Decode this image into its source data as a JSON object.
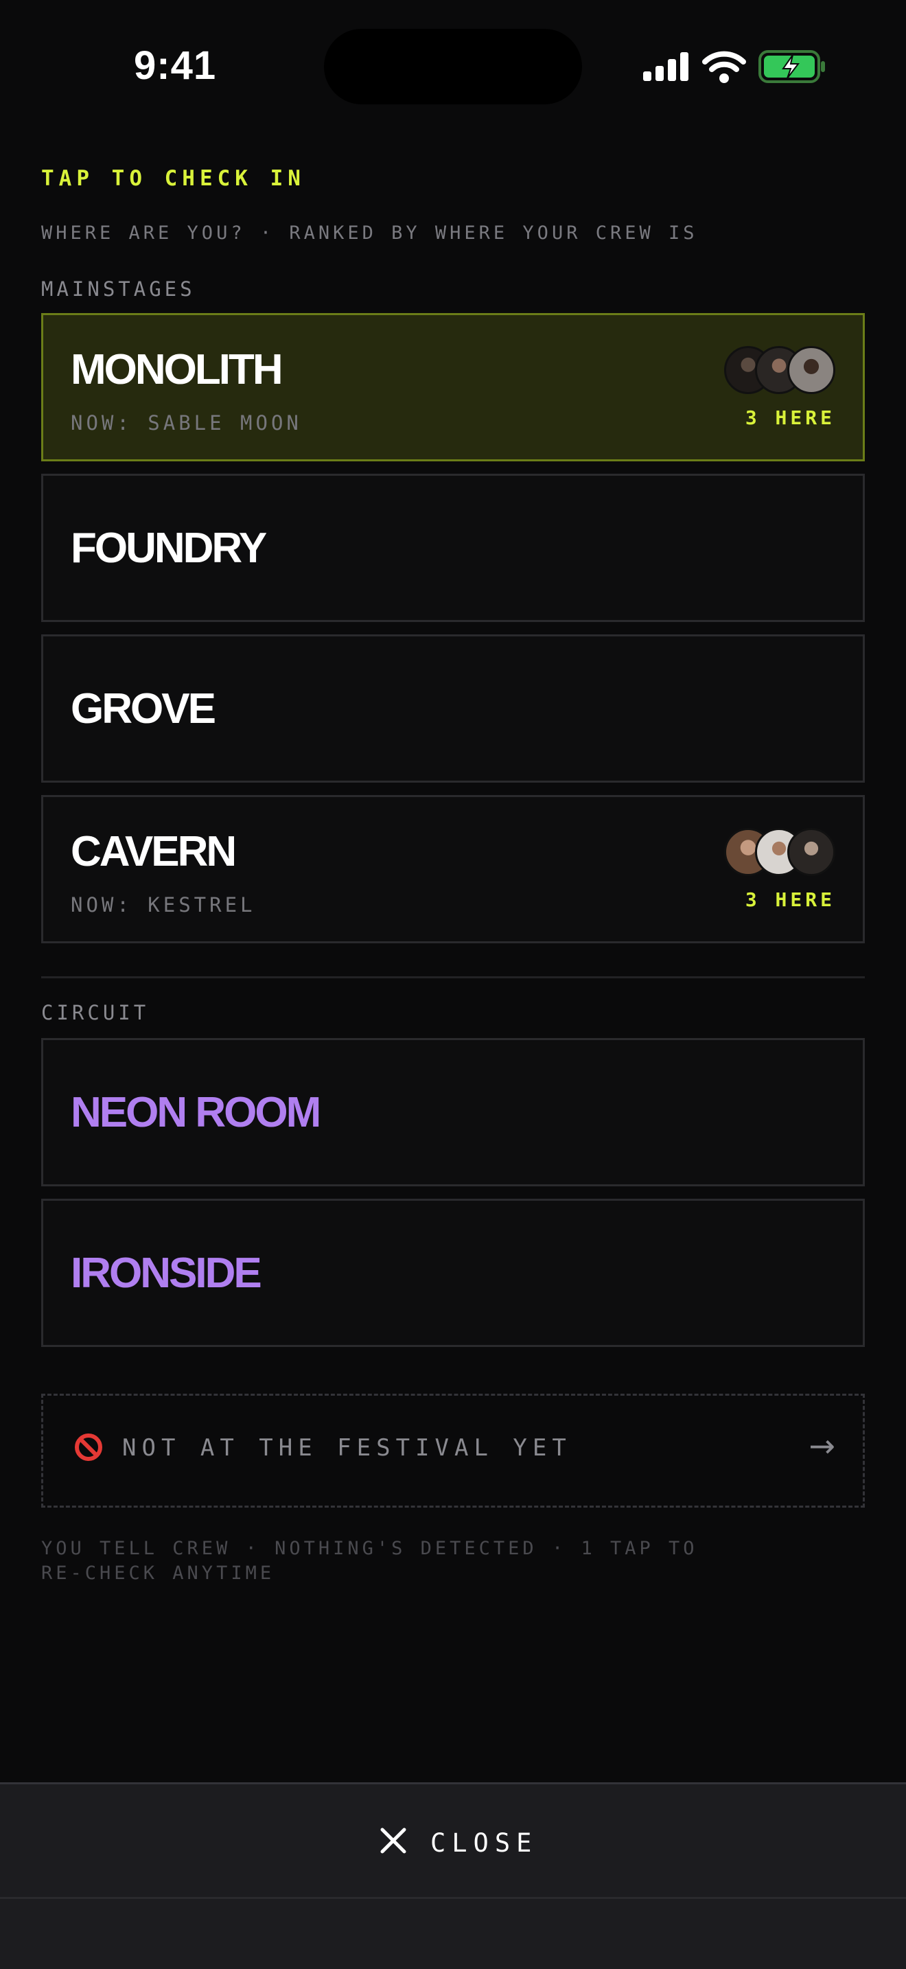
{
  "status_bar": {
    "time": "9:41"
  },
  "header": {
    "eyebrow": "TAP TO CHECK IN",
    "subtitle": "WHERE ARE YOU? · RANKED BY WHERE YOUR CREW IS"
  },
  "sections": {
    "mainstages_label": "MAINSTAGES",
    "circuit_label": "CIRCUIT"
  },
  "stages": {
    "monolith": {
      "name": "MONOLITH",
      "now": "NOW: SABLE MOON",
      "here": "3 HERE"
    },
    "foundry": {
      "name": "FOUNDRY"
    },
    "grove": {
      "name": "GROVE"
    },
    "cavern": {
      "name": "CAVERN",
      "now": "NOW: KESTREL",
      "here": "3 HERE"
    },
    "neon_room": {
      "name": "NEON ROOM"
    },
    "ironside": {
      "name": "IRONSIDE"
    }
  },
  "not_at_festival": {
    "label": "NOT AT THE FESTIVAL YET",
    "icon": "no-entry-icon",
    "arrow_icon": "arrow-right-icon"
  },
  "note": "YOU TELL CREW · NOTHING'S DETECTED · 1 TAP TO RE-CHECK ANYTIME",
  "close": {
    "label": "CLOSE",
    "icon": "close-icon"
  },
  "colors": {
    "accent": "#d9f23a",
    "circuit": "#b07ff0",
    "active_card_bg": "#262a0e",
    "background": "#0a0a0b"
  }
}
